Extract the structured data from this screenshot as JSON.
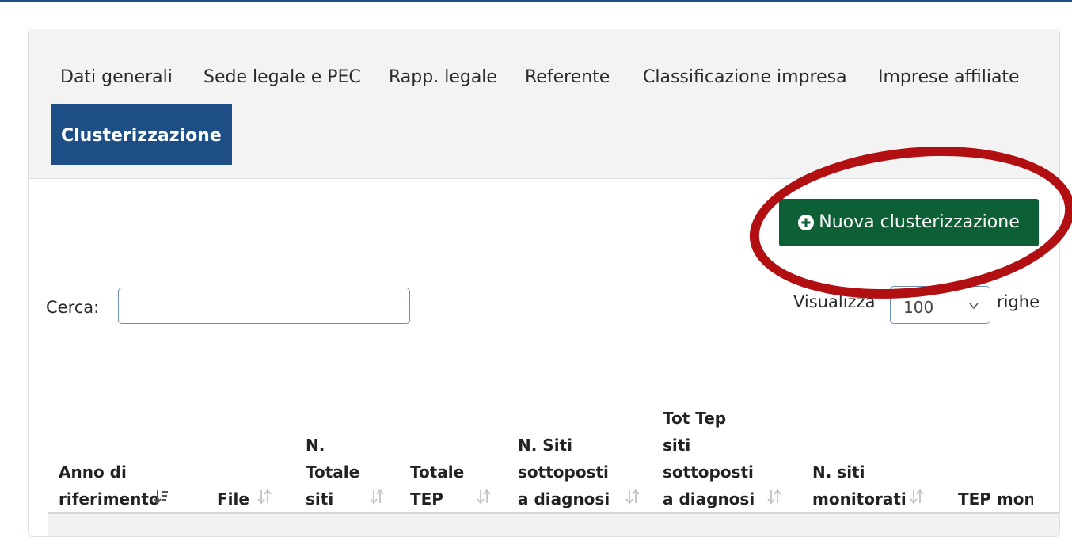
{
  "tabs": [
    {
      "label": "Dati generali"
    },
    {
      "label": "Sede legale e PEC"
    },
    {
      "label": "Rapp. legale"
    },
    {
      "label": "Referente"
    },
    {
      "label": "Classificazione impresa"
    },
    {
      "label": "Imprese affiliate"
    },
    {
      "label": "Clusterizzazione",
      "active": true
    }
  ],
  "toolbar": {
    "new_button_label": "Nuova clusterizzazione",
    "new_button_icon": "plus-circle-icon",
    "new_button_color": "#0d5f35"
  },
  "search": {
    "label": "Cerca:",
    "value": ""
  },
  "length": {
    "prefix": "Visualizza",
    "value": "100",
    "suffix": "righe"
  },
  "table": {
    "columns": [
      {
        "label": "Anno di riferimento",
        "sort": "desc-active"
      },
      {
        "label": "File",
        "sort": "both"
      },
      {
        "label": "N. Totale siti",
        "sort": "both"
      },
      {
        "label": "Totale TEP",
        "sort": "both"
      },
      {
        "label": "N. Siti sottoposti a diagnosi",
        "sort": "both"
      },
      {
        "label": "Tot Tep siti sottoposti a diagnosi",
        "sort": "both"
      },
      {
        "label": "N. siti monitorati",
        "sort": "both"
      },
      {
        "label": "TEP monitorati",
        "sort": "both"
      }
    ]
  },
  "colors": {
    "active_tab": "#1d4f86",
    "annotation": "#b10f12"
  }
}
